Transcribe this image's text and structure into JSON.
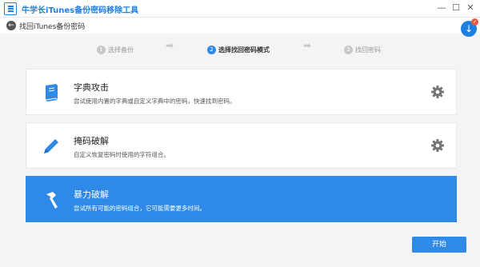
{
  "window": {
    "title": "牛学长iTunes备份密码移除工具",
    "minimize_glyph": "—",
    "maximize_glyph": "☐",
    "close_glyph": "✕"
  },
  "back": {
    "label": "找回iTunes备份密码",
    "arrow_glyph": "←"
  },
  "download": {
    "arrow_glyph": "↓",
    "badge_glyph": "✓"
  },
  "steps": [
    {
      "number": "1",
      "label": "选择备份",
      "active": false
    },
    {
      "number": "2",
      "label": "选择找回密码模式",
      "active": true
    },
    {
      "number": "3",
      "label": "找回密码",
      "active": false
    }
  ],
  "step_arrow_glyph": "➡",
  "modes": [
    {
      "title": "字典攻击",
      "description": "尝试使用内置的字典或自定义字典中的密码，快速找到密码。",
      "icon": "book-icon",
      "has_settings": true,
      "selected": false
    },
    {
      "title": "掩码破解",
      "description": "自定义恢复密码时使用的字符组合。",
      "icon": "pencil-icon",
      "has_settings": true,
      "selected": false
    },
    {
      "title": "暴力破解",
      "description": "尝试所有可能的密码组合，它可能需要更多时间。",
      "icon": "hammer-icon",
      "has_settings": false,
      "selected": true
    }
  ],
  "start_button": "开始",
  "colors": {
    "accent": "#2e8ae6",
    "title_blue": "#1f7fe0",
    "badge_red": "#e85a3a",
    "background": "#f4f4f4"
  }
}
